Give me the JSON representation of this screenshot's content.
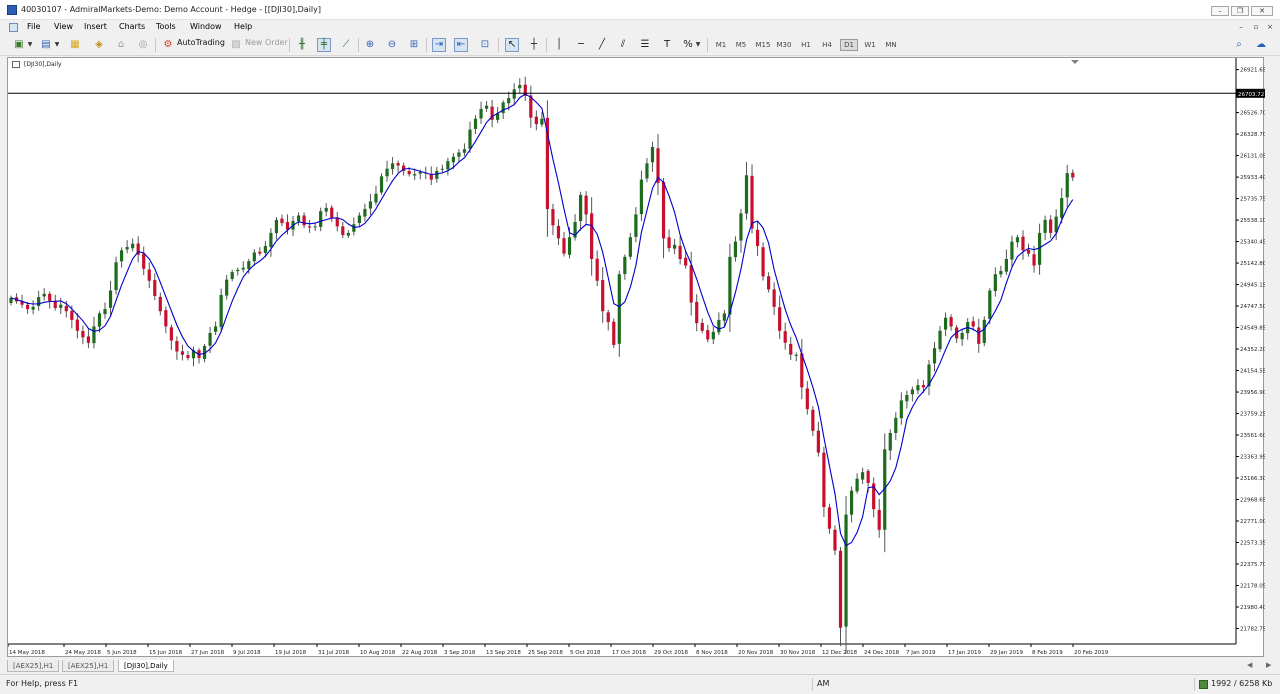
{
  "window": {
    "title": "40030107 - AdmiralMarkets-Demo: Demo Account - Hedge - [[DJI30],Daily]",
    "controls": {
      "minimize": "–",
      "restore": "❐",
      "close": "✕"
    }
  },
  "menu": {
    "items": [
      "File",
      "View",
      "Insert",
      "Charts",
      "Tools",
      "Window",
      "Help"
    ],
    "mdi_controls": [
      "–",
      "▫",
      "×"
    ]
  },
  "toolbar": {
    "autotrading_label": "AutoTrading",
    "new_order_label": "New Order",
    "timeframes": [
      "M1",
      "M5",
      "M15",
      "M30",
      "H1",
      "H4",
      "D1",
      "W1",
      "MN"
    ],
    "active_timeframe": "D1"
  },
  "chart": {
    "label": "[DJI30],Daily",
    "hline_value_label": "26703.72",
    "colors": {
      "bull": "#1d6b1d",
      "bear": "#c8102e",
      "ma": "#0000cc",
      "hline": "#000000",
      "price_tag_bg": "#000000",
      "price_tag_text": "#ffffff"
    }
  },
  "chart_data": {
    "type": "candlestick",
    "symbol": "[DJI30]",
    "timeframe": "Daily",
    "ylim": [
      21640,
      27010
    ],
    "y_ticks": [
      "26921.65",
      "26723.65",
      "26526.70",
      "26328.70",
      "26131.05",
      "25933.40",
      "25735.75",
      "25538.10",
      "25340.45",
      "25142.80",
      "24945.15",
      "24747.50",
      "24549.85",
      "24352.20",
      "24154.55",
      "23956.90",
      "23759.25",
      "23561.60",
      "23363.95",
      "23166.30",
      "22968.65",
      "22771.00",
      "22573.35",
      "22375.70",
      "22178.05",
      "21980.40",
      "21782.75"
    ],
    "x_ticks": [
      "14 May 2018",
      "24 May 2018",
      "5 Jun 2018",
      "15 Jun 2018",
      "27 Jun 2018",
      "9 Jul 2018",
      "19 Jul 2018",
      "31 Jul 2018",
      "10 Aug 2018",
      "22 Aug 2018",
      "3 Sep 2018",
      "13 Sep 2018",
      "25 Sep 2018",
      "5 Oct 2018",
      "17 Oct 2018",
      "29 Oct 2018",
      "8 Nov 2018",
      "20 Nov 2018",
      "30 Nov 2018",
      "12 Dec 2018",
      "24 Dec 2018",
      "7 Jan 2019",
      "17 Jan 2019",
      "29 Jan 2019",
      "8 Feb 2019",
      "20 Feb 2019"
    ],
    "horizontal_line": 26703.72,
    "grid": false,
    "closes": [
      24823,
      24790,
      24760,
      24720,
      24740,
      24830,
      24860,
      24795,
      24730,
      24760,
      24700,
      24620,
      24520,
      24460,
      24410,
      24560,
      24680,
      24720,
      24890,
      25150,
      25260,
      25290,
      25320,
      25220,
      25090,
      24980,
      24840,
      24700,
      24560,
      24430,
      24330,
      24300,
      24270,
      24340,
      24270,
      24380,
      24500,
      24560,
      24850,
      24990,
      25060,
      25080,
      25100,
      25160,
      25240,
      25230,
      25300,
      25420,
      25540,
      25510,
      25450,
      25530,
      25580,
      25490,
      25470,
      25480,
      25620,
      25650,
      25560,
      25480,
      25400,
      25420,
      25500,
      25580,
      25640,
      25710,
      25780,
      25940,
      26010,
      26060,
      26040,
      25990,
      25960,
      25960,
      25980,
      25970,
      25910,
      25990,
      26010,
      26080,
      26120,
      26160,
      26190,
      26370,
      26470,
      26560,
      26590,
      26460,
      26520,
      26620,
      26660,
      26740,
      26780,
      26680,
      26480,
      26420,
      26470,
      25640,
      25490,
      25370,
      25230,
      25380,
      25520,
      25770,
      25590,
      25180,
      24980,
      24700,
      24600,
      24390,
      25040,
      25200,
      25380,
      25590,
      25910,
      26060,
      26210,
      25880,
      25370,
      25280,
      25310,
      25180,
      25120,
      24780,
      24590,
      24520,
      24440,
      24510,
      24620,
      24680,
      25200,
      25340,
      25600,
      25950,
      25460,
      25300,
      25020,
      24900,
      24740,
      24520,
      24410,
      24300,
      24300,
      24000,
      23800,
      23600,
      23400,
      22900,
      22700,
      22500,
      21790,
      22830,
      23050,
      23160,
      23220,
      23120,
      22880,
      22690,
      23430,
      23580,
      23720,
      23880,
      23930,
      23980,
      24020,
      24000,
      24210,
      24360,
      24520,
      24640,
      24560,
      24450,
      24500,
      24600,
      24560,
      24400,
      24620,
      24890,
      25040,
      25070,
      25180,
      25340,
      25380,
      25260,
      25230,
      25120,
      25420,
      25540,
      25420,
      25570,
      25740,
      25970,
      25930
    ],
    "ma_period": 5
  }
}
